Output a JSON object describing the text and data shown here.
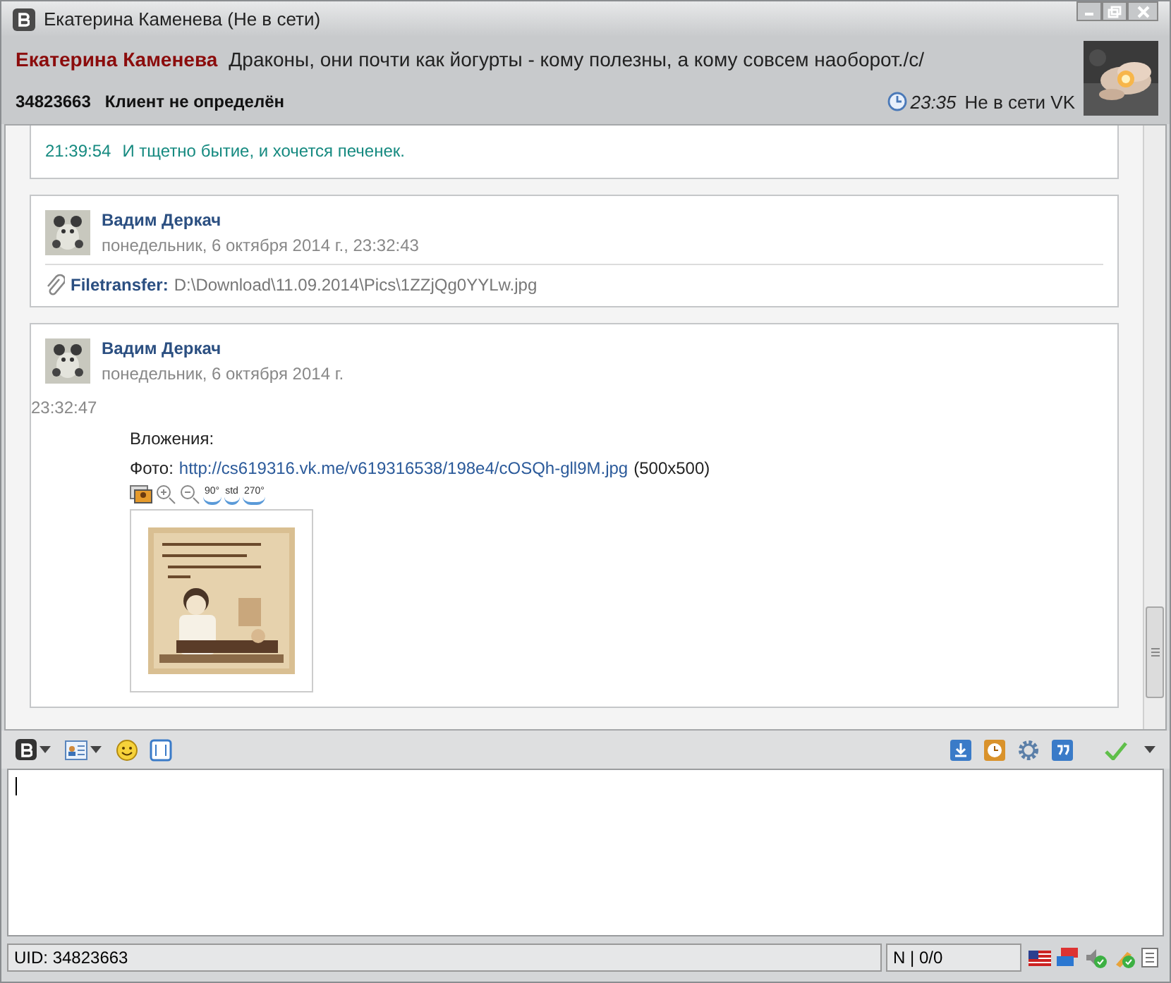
{
  "window": {
    "title": "Екатерина Каменева (Не в сети)"
  },
  "header": {
    "name": "Екатерина Каменева",
    "status_text": "Драконы, они почти как йогурты - кому полезны, а кому совсем наоборот./c/",
    "uid": "34823663",
    "client": "Клиент не определён",
    "time": "23:35",
    "presence": "Не в сети VK"
  },
  "messages": [
    {
      "kind": "line",
      "time": "21:39:54",
      "text": "И тщетно бытие, и хочется печенек."
    },
    {
      "kind": "file",
      "author": "Вадим Деркач",
      "date": "понедельник, 6 октября 2014 г., 23:32:43",
      "label": "Filetransfer:",
      "path": "D:\\Download\\11.09.2014\\Pics\\1ZZjQg0YYLw.jpg"
    },
    {
      "kind": "attachment",
      "author": "Вадим Деркач",
      "date": "понедельник, 6 октября 2014 г.",
      "time": "23:32:47",
      "heading": "Вложения:",
      "photo_label": "Фото:",
      "url": "http://cs619316.vk.me/v619316538/198e4/cOSQh-gll9M.jpg",
      "size": "(500x500)",
      "rotate_buttons": [
        "90°",
        "std",
        "270°"
      ]
    }
  ],
  "status_bar": {
    "uid": "UID: 34823663",
    "counter": "N | 0/0"
  }
}
